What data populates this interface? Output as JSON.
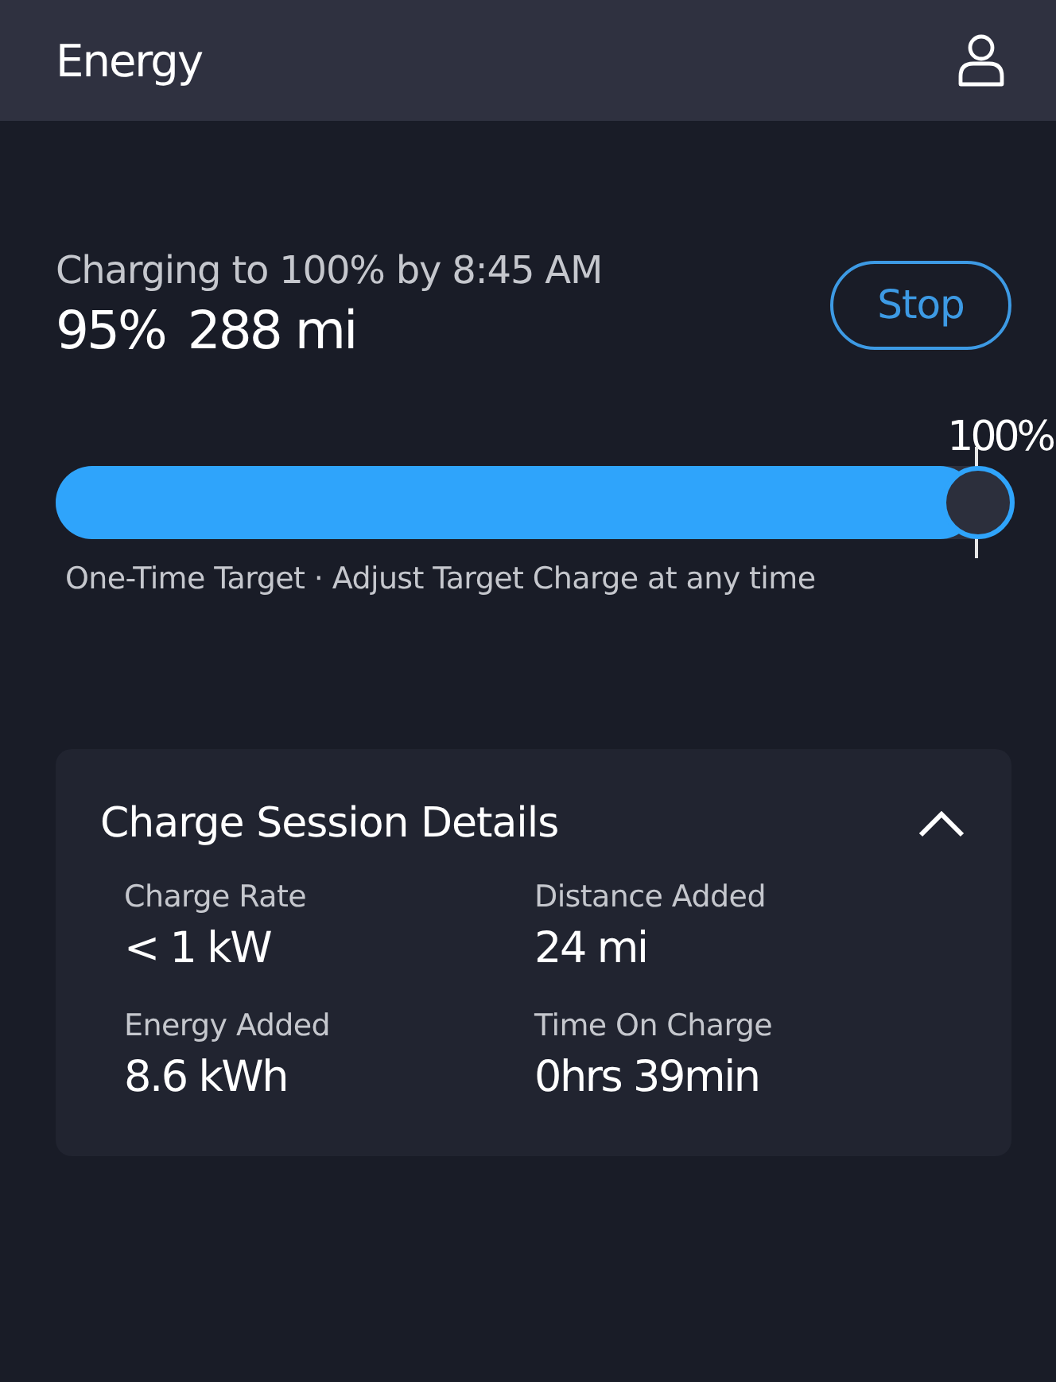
{
  "header": {
    "title": "Energy"
  },
  "status": {
    "headline": "Charging to 100% by 8:45 AM",
    "soc": "95%",
    "range": "288 mi",
    "button": "Stop"
  },
  "slider": {
    "label": "100%",
    "level": 1,
    "caption": "One-Time Target · Adjust Target Charge at any time"
  },
  "details": {
    "title": "Charge Session Details",
    "expanded": true,
    "items": [
      {
        "label": "Charge Rate",
        "value": "< 1 kW"
      },
      {
        "label": "Distance Added",
        "value": "24 mi"
      },
      {
        "label": "Energy Added",
        "value": "8.6 kWh"
      },
      {
        "label": "Time On Charge",
        "value": "0hrs 39min"
      }
    ]
  }
}
